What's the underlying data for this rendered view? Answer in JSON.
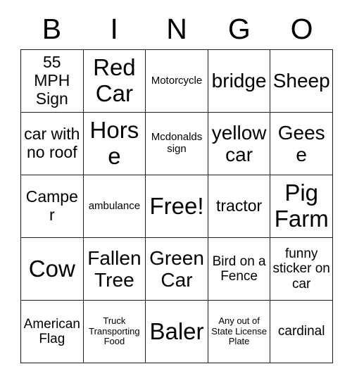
{
  "card": {
    "header_letters": [
      "B",
      "I",
      "N",
      "G",
      "O"
    ],
    "columns": 5,
    "rows": 5,
    "border_color": "#1a1a1a",
    "background_color": "#ffffff",
    "text_color": "#000000",
    "free_space_label": "Free!",
    "cells": [
      [
        {
          "text": "55 MPH Sign",
          "size": "md"
        },
        {
          "text": "Red Car",
          "size": "xl"
        },
        {
          "text": "Motorcycle",
          "size": "xs"
        },
        {
          "text": "bridge",
          "size": "lg"
        },
        {
          "text": "Sheep",
          "size": "lg"
        }
      ],
      [
        {
          "text": "car with no roof",
          "size": "md"
        },
        {
          "text": "Horse",
          "size": "xl"
        },
        {
          "text": "Mcdonalds sign",
          "size": "xs"
        },
        {
          "text": "yellow car",
          "size": "lg"
        },
        {
          "text": "Geese",
          "size": "lg"
        }
      ],
      [
        {
          "text": "Camper",
          "size": "md"
        },
        {
          "text": "ambulance",
          "size": "xs"
        },
        {
          "text": "Free!",
          "size": "xl"
        },
        {
          "text": "tractor",
          "size": "md"
        },
        {
          "text": "Pig Farm",
          "size": "xl"
        }
      ],
      [
        {
          "text": "Cow",
          "size": "xl"
        },
        {
          "text": "Fallen Tree",
          "size": "lg"
        },
        {
          "text": "Green Car",
          "size": "lg"
        },
        {
          "text": "Bird on a Fence",
          "size": "sm"
        },
        {
          "text": "funny sticker on car",
          "size": "sm"
        }
      ],
      [
        {
          "text": "American Flag",
          "size": "sm"
        },
        {
          "text": "Truck Transporting Food",
          "size": "xxs"
        },
        {
          "text": "Baler",
          "size": "xl"
        },
        {
          "text": "Any out of State License Plate",
          "size": "xxs"
        },
        {
          "text": "cardinal",
          "size": "sm"
        }
      ]
    ]
  }
}
